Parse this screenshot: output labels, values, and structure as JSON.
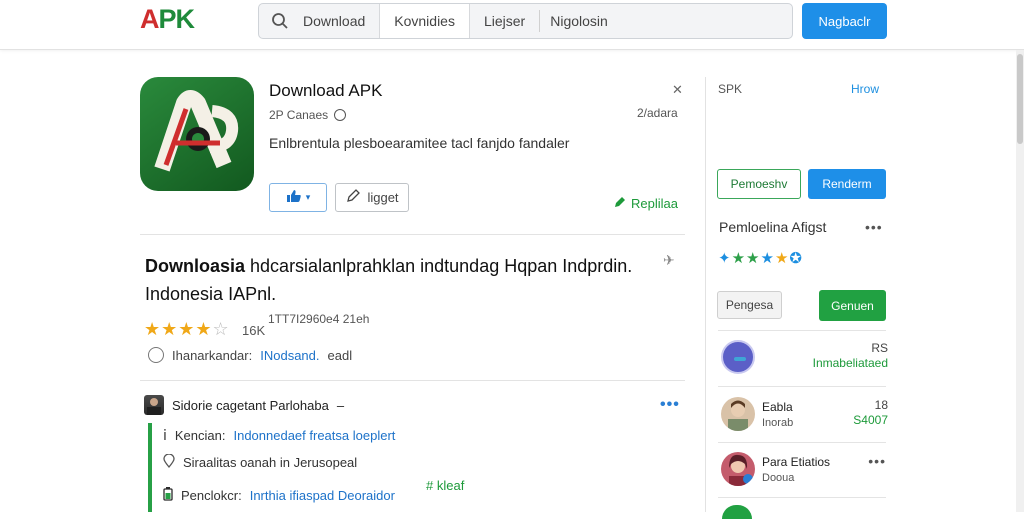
{
  "header": {
    "logo_a": "A",
    "logo_pk": "PK",
    "tabs": [
      {
        "label": "Download"
      },
      {
        "label": "Kovnidies"
      },
      {
        "label": "Liejser"
      }
    ],
    "search_value": "Nigolosin",
    "top_button": "Nagbaclr"
  },
  "app": {
    "title": "Download APK",
    "developer": "2P Canaes",
    "size": "2/adara",
    "description": "Enlbrentula plesboearamitee tacl fanjdo fandaler",
    "edit_label": "ligget",
    "replica_label": "Replilaa"
  },
  "article": {
    "headline_first": "Downloasia",
    "headline_rest": " hdcarsialanlprahklan indtundag Hqpan Indprdin. Indonesia IAPnl.",
    "rating_count": "16K",
    "rating_meta": "1TT7I2960e4 21eh",
    "info_label": "Ihanarkandar:",
    "info_link": "INodsand.",
    "info_tag": "eadl"
  },
  "thread": {
    "author": "Sidorie cagetant Parlohaba",
    "items": [
      {
        "prefix": "Kencian:",
        "link": "Indonnedaef freatsa loeplert"
      },
      {
        "prefix": "",
        "text": "Siraalitas oanah in Jerusopeal"
      },
      {
        "prefix": "Penclokcr:",
        "link": "Inrthia ifiaspad Deoraidor"
      }
    ],
    "tag": "# kleaf"
  },
  "sidebar": {
    "title": "SPK",
    "link": "Hrow",
    "btn_outline": "Pemoeshv",
    "btn_blue": "Renderm",
    "subtitle": "Pemloelina Afigst",
    "btn_grey": "Pengesa",
    "btn_green": "Genuen",
    "items": [
      {
        "name": "",
        "sub": "",
        "val1": "RS",
        "val2": "Inmabeliataed"
      },
      {
        "name": "Eabla",
        "sub": "Inorab",
        "val1": "18",
        "val2": "S4007"
      },
      {
        "name": "Para Etiatios",
        "sub": "Dooua",
        "val1": "",
        "val2": ""
      }
    ]
  },
  "colors": {
    "accent_blue": "#1e8fe8",
    "accent_green": "#21a142",
    "star_yellow": "#f0a818"
  }
}
